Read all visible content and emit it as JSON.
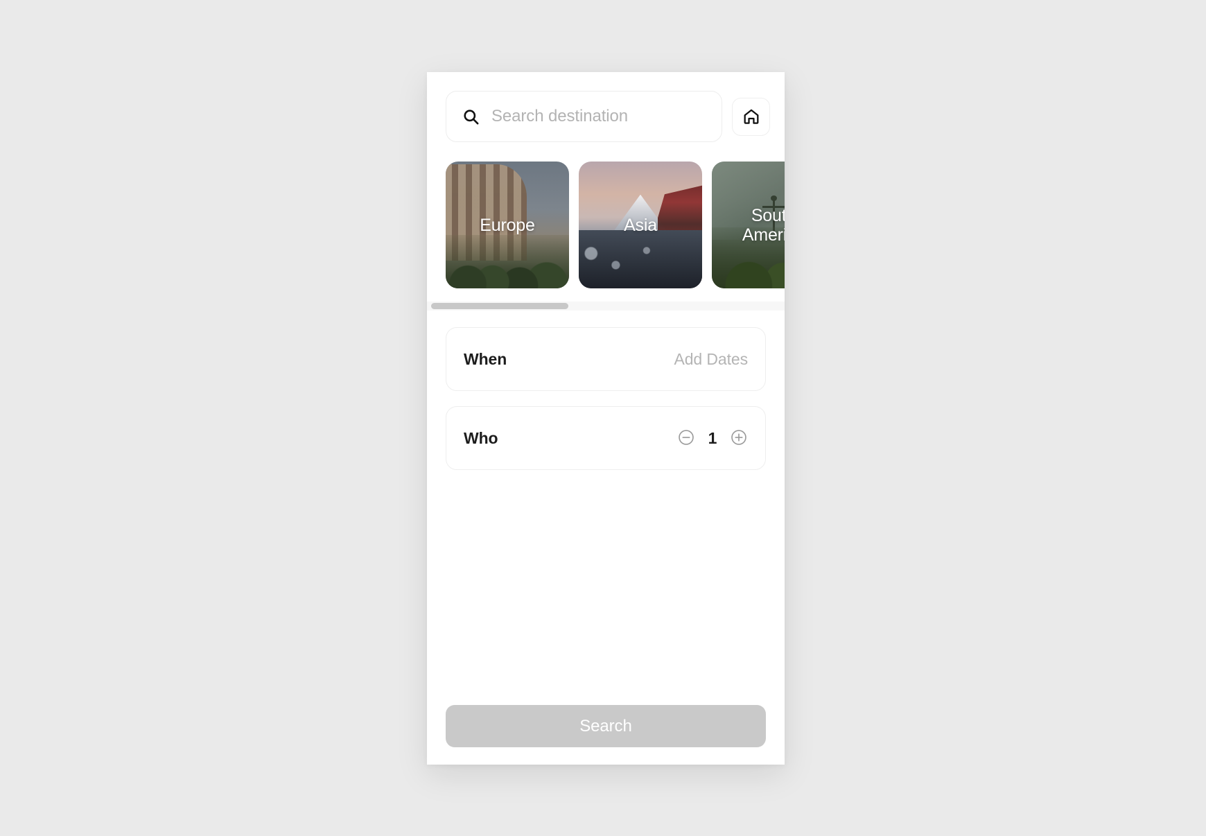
{
  "app": {
    "background_color": "#eaeaea",
    "panel_color": "#ffffff"
  },
  "search": {
    "icon": "search-icon",
    "placeholder": "Search destination",
    "value": "",
    "home_button_icon": "home-icon"
  },
  "destinations": {
    "scroll_thumb_position": "left",
    "cards": [
      {
        "label": "Europe",
        "art": "colosseum-rome"
      },
      {
        "label": "Asia",
        "art": "mount-fuji-pagoda"
      },
      {
        "label": "South\nAmerica",
        "art": "christ-the-redeemer-rio"
      }
    ]
  },
  "options": [
    {
      "id": "when",
      "label": "When",
      "value": "Add Dates",
      "value_color": "#b4b4b4"
    },
    {
      "id": "who",
      "label": "Who",
      "count": "1",
      "decrement_icon": "circle-minus-icon",
      "increment_icon": "circle-plus-icon"
    }
  ],
  "footer": {
    "search_label": "Search",
    "search_button_color": "#c9c9c9",
    "search_button_text_color": "#ffffff",
    "enabled": false
  }
}
